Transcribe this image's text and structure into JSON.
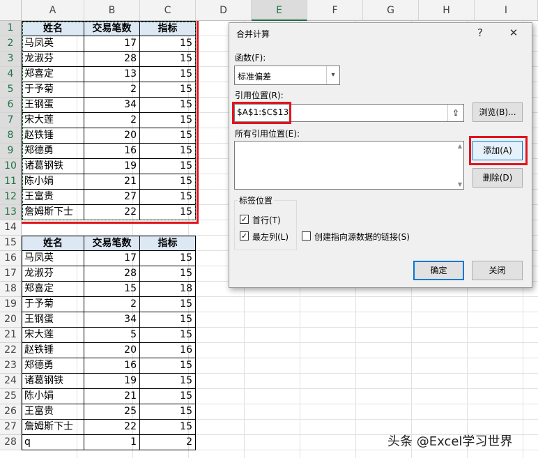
{
  "columns": [
    "A",
    "B",
    "C",
    "D",
    "E",
    "F",
    "G",
    "H",
    "I"
  ],
  "selected_column": "E",
  "rows": [
    "1",
    "2",
    "3",
    "4",
    "5",
    "6",
    "7",
    "8",
    "9",
    "10",
    "11",
    "12",
    "13",
    "14",
    "15",
    "16",
    "17",
    "18",
    "19",
    "20",
    "21",
    "22",
    "23",
    "24",
    "25",
    "26",
    "27",
    "28"
  ],
  "table1": {
    "headers": [
      "姓名",
      "交易笔数",
      "指标"
    ],
    "rows": [
      [
        "马凤英",
        "17",
        "15"
      ],
      [
        "龙淑芬",
        "28",
        "15"
      ],
      [
        "郑喜定",
        "13",
        "15"
      ],
      [
        "于予菊",
        "2",
        "15"
      ],
      [
        "王钢蛋",
        "34",
        "15"
      ],
      [
        "宋大莲",
        "2",
        "15"
      ],
      [
        "赵铁锤",
        "20",
        "15"
      ],
      [
        "郑德勇",
        "16",
        "15"
      ],
      [
        "诸葛钢铁",
        "19",
        "15"
      ],
      [
        "陈小娟",
        "21",
        "15"
      ],
      [
        "王富贵",
        "27",
        "15"
      ],
      [
        "詹姆斯下士",
        "22",
        "15"
      ]
    ]
  },
  "table2": {
    "headers": [
      "姓名",
      "交易笔数",
      "指标"
    ],
    "rows": [
      [
        "马凤英",
        "17",
        "15"
      ],
      [
        "龙淑芬",
        "28",
        "15"
      ],
      [
        "郑喜定",
        "15",
        "18"
      ],
      [
        "于予菊",
        "2",
        "15"
      ],
      [
        "王钢蛋",
        "34",
        "15"
      ],
      [
        "宋大莲",
        "5",
        "15"
      ],
      [
        "赵铁锤",
        "20",
        "16"
      ],
      [
        "郑德勇",
        "16",
        "15"
      ],
      [
        "诸葛钢铁",
        "19",
        "15"
      ],
      [
        "陈小娟",
        "21",
        "15"
      ],
      [
        "王富贵",
        "25",
        "15"
      ],
      [
        "詹姆斯下士",
        "22",
        "15"
      ],
      [
        "q",
        "1",
        "2"
      ]
    ]
  },
  "dialog": {
    "title": "合并计算",
    "help": "?",
    "close": "✕",
    "function_label": "函数(F):",
    "function_value": "标准偏差",
    "ref_label": "引用位置(R):",
    "ref_value": "$A$1:$C$13",
    "browse": "浏览(B)...",
    "all_refs_label": "所有引用位置(E):",
    "add": "添加(A)",
    "delete": "删除(D)",
    "label_group": "标签位置",
    "first_row": "首行(T)",
    "left_col": "最左列(L)",
    "create_links": "创建指向源数据的链接(S)",
    "ok": "确定",
    "cancel": "关闭"
  },
  "watermark": "头条 @Excel学习世界",
  "colors": {
    "highlight": "#e0141e",
    "header_fill": "#dde8f5",
    "accent": "#0078d7"
  }
}
